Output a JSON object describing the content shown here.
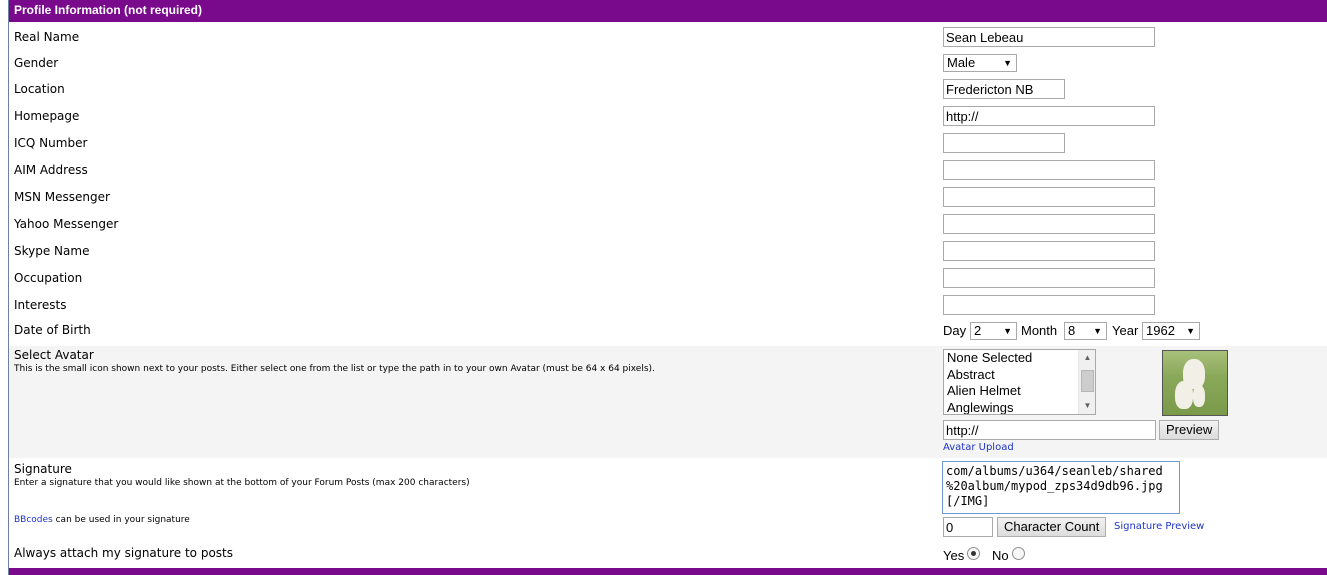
{
  "section_title": "Profile Information (not required)",
  "fields": {
    "real_name": {
      "label": "Real Name",
      "value": "Sean Lebeau"
    },
    "gender": {
      "label": "Gender",
      "value": "Male"
    },
    "location": {
      "label": "Location",
      "value": "Fredericton NB"
    },
    "homepage": {
      "label": "Homepage",
      "value": "http://"
    },
    "icq": {
      "label": "ICQ Number",
      "value": ""
    },
    "aim": {
      "label": "AIM Address",
      "value": ""
    },
    "msn": {
      "label": "MSN Messenger",
      "value": ""
    },
    "yahoo": {
      "label": "Yahoo Messenger",
      "value": ""
    },
    "skype": {
      "label": "Skype Name",
      "value": ""
    },
    "occupation": {
      "label": "Occupation",
      "value": ""
    },
    "interests": {
      "label": "Interests",
      "value": ""
    }
  },
  "dob": {
    "label": "Date of Birth",
    "day_label": "Day",
    "day_value": "2",
    "month_label": "Month",
    "month_value": "8",
    "year_label": "Year",
    "year_value": "1962"
  },
  "avatar": {
    "label": "Select Avatar",
    "description": "This is the small icon shown next to your posts. Either select one from the list or type the path in to your own Avatar (must be 64 x 64 pixels).",
    "options": [
      "None Selected",
      "Abstract",
      "Alien Helmet",
      "Anglewings"
    ],
    "path_value": "http://",
    "preview_button": "Preview",
    "upload_link": "Avatar Upload"
  },
  "signature": {
    "label": "Signature",
    "description": "Enter a signature that you would like shown at the bottom of your Forum Posts (max 200 characters)",
    "bbcodes_link": "BBcodes",
    "bbcodes_text": " can be used in your signature",
    "textarea_lines": [
      "com/albums/u364/seanleb/shared",
      "%20album/mypod_zps34d9db96.jpg",
      "[/IMG]"
    ],
    "char_count_value": "0",
    "char_count_button": "Character Count",
    "preview_link": "Signature Preview"
  },
  "attach_signature": {
    "label": "Always attach my signature to posts",
    "yes_label": "Yes",
    "no_label": "No",
    "selected": "Yes"
  },
  "colors": {
    "header_bg": "#7a0a8c",
    "link": "#1e34c8"
  }
}
